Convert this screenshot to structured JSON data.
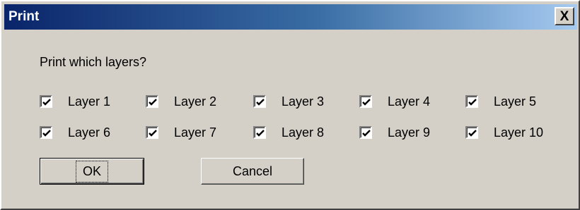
{
  "window": {
    "title": "Print",
    "close_glyph": "X"
  },
  "dialog": {
    "prompt": "Print which layers?",
    "layers": [
      {
        "label": "Layer 1",
        "checked": true
      },
      {
        "label": "Layer 2",
        "checked": true
      },
      {
        "label": "Layer 3",
        "checked": true
      },
      {
        "label": "Layer 4",
        "checked": true
      },
      {
        "label": "Layer 5",
        "checked": true
      },
      {
        "label": "Layer 6",
        "checked": true
      },
      {
        "label": "Layer 7",
        "checked": true
      },
      {
        "label": "Layer 8",
        "checked": true
      },
      {
        "label": "Layer 9",
        "checked": true
      },
      {
        "label": "Layer 10",
        "checked": true
      }
    ],
    "ok_label": "OK",
    "cancel_label": "Cancel"
  },
  "colors": {
    "face": "#d4d0c8",
    "title_start": "#0a246a",
    "title_end": "#a6caf0"
  },
  "icons": {
    "close": "close-icon",
    "check": "checkmark-icon"
  }
}
